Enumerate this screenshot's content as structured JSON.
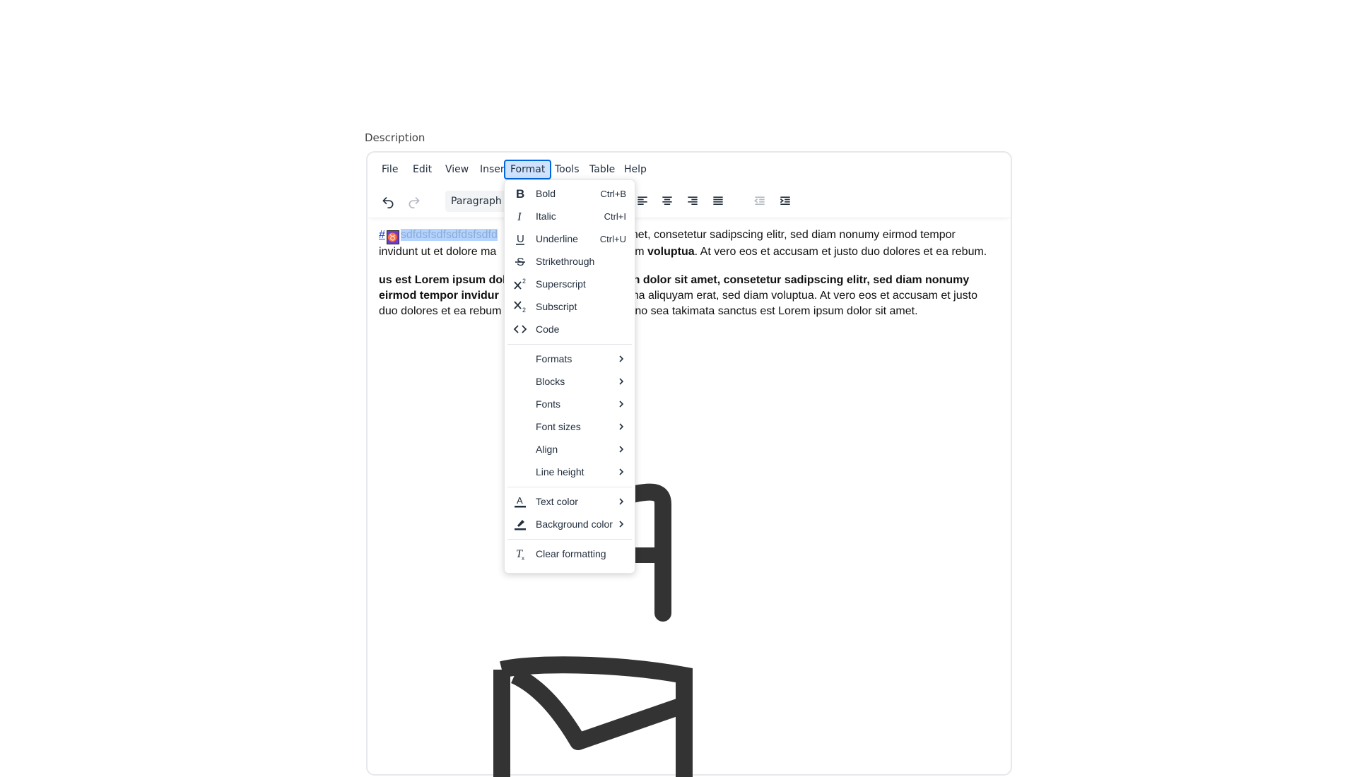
{
  "field_label": "Description",
  "menubar": {
    "items": [
      {
        "label": "File"
      },
      {
        "label": "Edit"
      },
      {
        "label": "View"
      },
      {
        "label": "Insert"
      },
      {
        "label": "Format"
      },
      {
        "label": "Tools"
      },
      {
        "label": "Table"
      },
      {
        "label": "Help"
      }
    ]
  },
  "toolbar": {
    "block_format": "Paragraph"
  },
  "content": {
    "p1_hash": "#",
    "p1_emoji": "♉",
    "p1_selected": "sdfdsfsdfsdfdsfsdfd",
    "p1_after_line1": "net, consetetur sadipscing elitr, sed diam nonumy eirmod tempor",
    "p1_line2_start": "invidunt ut  et dolore ma",
    "p1_line2_mid": "am ",
    "p1_line2_bold": "voluptua",
    "p1_line2_end": ". At vero eos et accusam et justo duo dolores et ea rebum.",
    "p2_line1_left": "us est Lorem ipsum dol",
    "p2_line1_right": "n dolor sit amet, consetetur sadipscing elitr, sed diam nonumy",
    "p2_line2_left": "eirmod tempor invidur",
    "p2_line2_right": "gna aliquyam erat, sed diam voluptua. At vero eos et accusam et justo",
    "p2_line3_left": "duo dolores et ea rebum",
    "p2_line3_right": ", no sea takimata sanctus est Lorem ipsum dolor sit amet."
  },
  "format_menu": {
    "items": [
      {
        "label": "Bold",
        "shortcut": "Ctrl+B",
        "icon": "bold-icon"
      },
      {
        "label": "Italic",
        "shortcut": "Ctrl+I",
        "icon": "italic-icon"
      },
      {
        "label": "Underline",
        "shortcut": "Ctrl+U",
        "icon": "underline-icon"
      },
      {
        "label": "Strikethrough",
        "icon": "strikethrough-icon"
      },
      {
        "label": "Superscript",
        "icon": "superscript-icon"
      },
      {
        "label": "Subscript",
        "icon": "subscript-icon"
      },
      {
        "label": "Code",
        "icon": "code-icon"
      },
      {
        "label": "Formats"
      },
      {
        "label": "Blocks"
      },
      {
        "label": "Fonts"
      },
      {
        "label": "Font sizes"
      },
      {
        "label": "Align"
      },
      {
        "label": "Line height"
      },
      {
        "label": "Text color",
        "icon": "text-color-icon"
      },
      {
        "label": "Background color",
        "icon": "background-color-icon"
      },
      {
        "label": "Clear formatting",
        "icon": "clear-formatting-icon"
      }
    ]
  },
  "colors": {
    "accent": "#0066e0",
    "selection": "#b4d4ff"
  }
}
